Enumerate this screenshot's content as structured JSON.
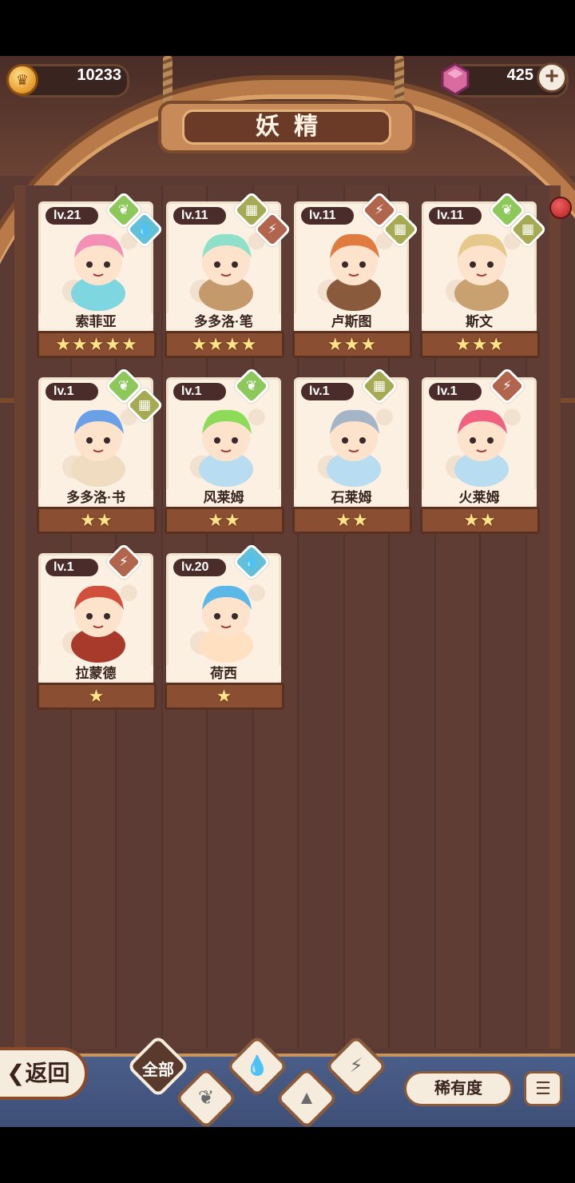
{
  "header": {
    "title": "妖精",
    "coins": "10233",
    "gems": "425"
  },
  "cards": [
    {
      "level": "lv.21",
      "name": "索菲亚",
      "stars": "★★★★★",
      "elements": [
        "grass",
        "water"
      ]
    },
    {
      "level": "lv.11",
      "name": "多多洛·笔",
      "stars": "★★★★",
      "elements": [
        "rock",
        "fire"
      ]
    },
    {
      "level": "lv.11",
      "name": "卢斯图",
      "stars": "★★★",
      "elements": [
        "fire",
        "rock"
      ]
    },
    {
      "level": "lv.11",
      "name": "斯文",
      "stars": "★★★",
      "elements": [
        "grass",
        "rock"
      ]
    },
    {
      "level": "lv.1",
      "name": "多多洛·书",
      "stars": "★★",
      "elements": [
        "grass",
        "rock"
      ]
    },
    {
      "level": "lv.1",
      "name": "风莱姆",
      "stars": "★★",
      "elements": [
        "grass"
      ]
    },
    {
      "level": "lv.1",
      "name": "石莱姆",
      "stars": "★★",
      "elements": [
        "rock"
      ]
    },
    {
      "level": "lv.1",
      "name": "火莱姆",
      "stars": "★★",
      "elements": [
        "fire"
      ]
    },
    {
      "level": "lv.1",
      "name": "拉蒙德",
      "stars": "★",
      "elements": [
        "fire"
      ]
    },
    {
      "level": "lv.20",
      "name": "荷西",
      "stars": "★",
      "elements": [
        "water"
      ]
    }
  ],
  "footer": {
    "back_label": "返回",
    "filter_all": "全部",
    "rarity_label": "稀有度"
  }
}
